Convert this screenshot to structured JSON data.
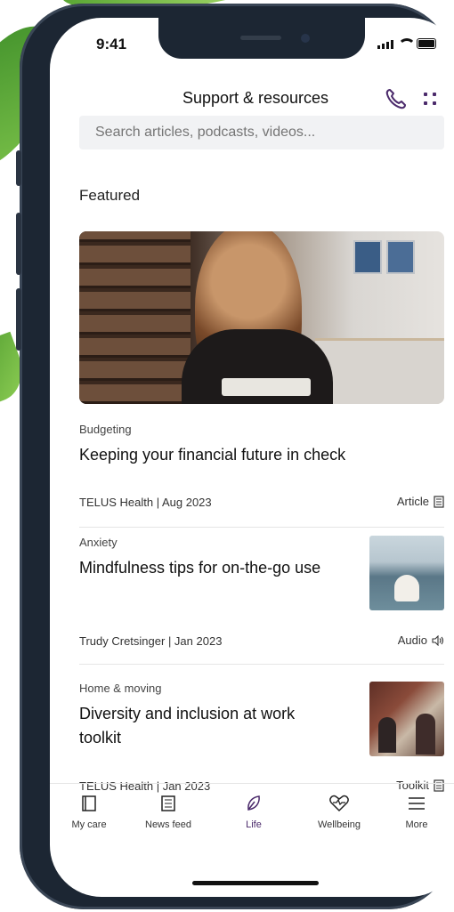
{
  "status_bar": {
    "time": "9:41"
  },
  "header": {
    "title": "Support & resources"
  },
  "search": {
    "placeholder": "Search articles, podcasts, videos..."
  },
  "featured": {
    "section_title": "Featured",
    "article": {
      "category": "Budgeting",
      "title": "Keeping your financial future in check",
      "meta": "TELUS Health | Aug 2023",
      "type": "Article"
    }
  },
  "list": [
    {
      "category": "Anxiety",
      "title": "Mindfulness tips for on-the-go use",
      "meta": "Trudy Cretsinger | Jan 2023",
      "type": "Audio"
    },
    {
      "category": "Home & moving",
      "title": "Diversity and inclusion at work toolkit",
      "meta": "TELUS Health | Jan 2023",
      "type": "Toolkit"
    }
  ],
  "tabs": [
    {
      "label": "My care",
      "icon": "book-icon"
    },
    {
      "label": "News feed",
      "icon": "newsfeed-icon"
    },
    {
      "label": "Life",
      "icon": "leaf-icon",
      "active": true
    },
    {
      "label": "Wellbeing",
      "icon": "heart-pulse-icon"
    },
    {
      "label": "More",
      "icon": "menu-icon"
    }
  ],
  "colors": {
    "accent": "#4b2a6b",
    "frame": "#1c2633",
    "search_bg": "#f1f2f4"
  }
}
